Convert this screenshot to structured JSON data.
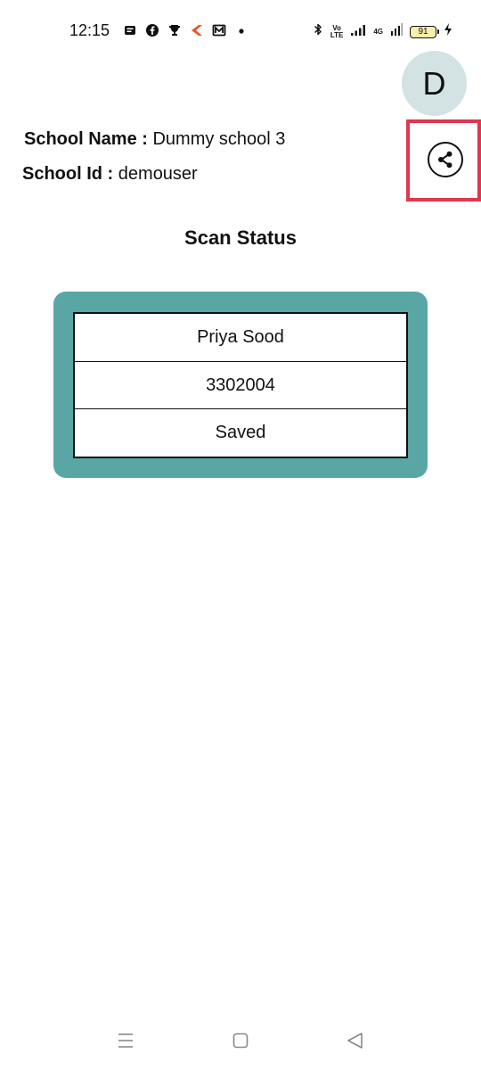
{
  "status_bar": {
    "time": "12:15",
    "volte_top": "Vo",
    "volte_bottom": "LTE",
    "network": "4G",
    "battery": "91"
  },
  "avatar": {
    "initial": "D"
  },
  "school": {
    "name_label": "School Name :",
    "name_value": "Dummy school 3",
    "id_label": "School Id :",
    "id_value": "demouser"
  },
  "scan_status": {
    "title": "Scan Status",
    "rows": [
      "Priya Sood",
      "3302004",
      "Saved"
    ]
  },
  "colors": {
    "card": "#59a6a5",
    "avatar_bg": "#d3e3e3",
    "highlight": "#e0364e"
  },
  "icons": {
    "share": "share-icon",
    "nav_recents": "recents-icon",
    "nav_home": "home-icon",
    "nav_back": "back-icon"
  }
}
